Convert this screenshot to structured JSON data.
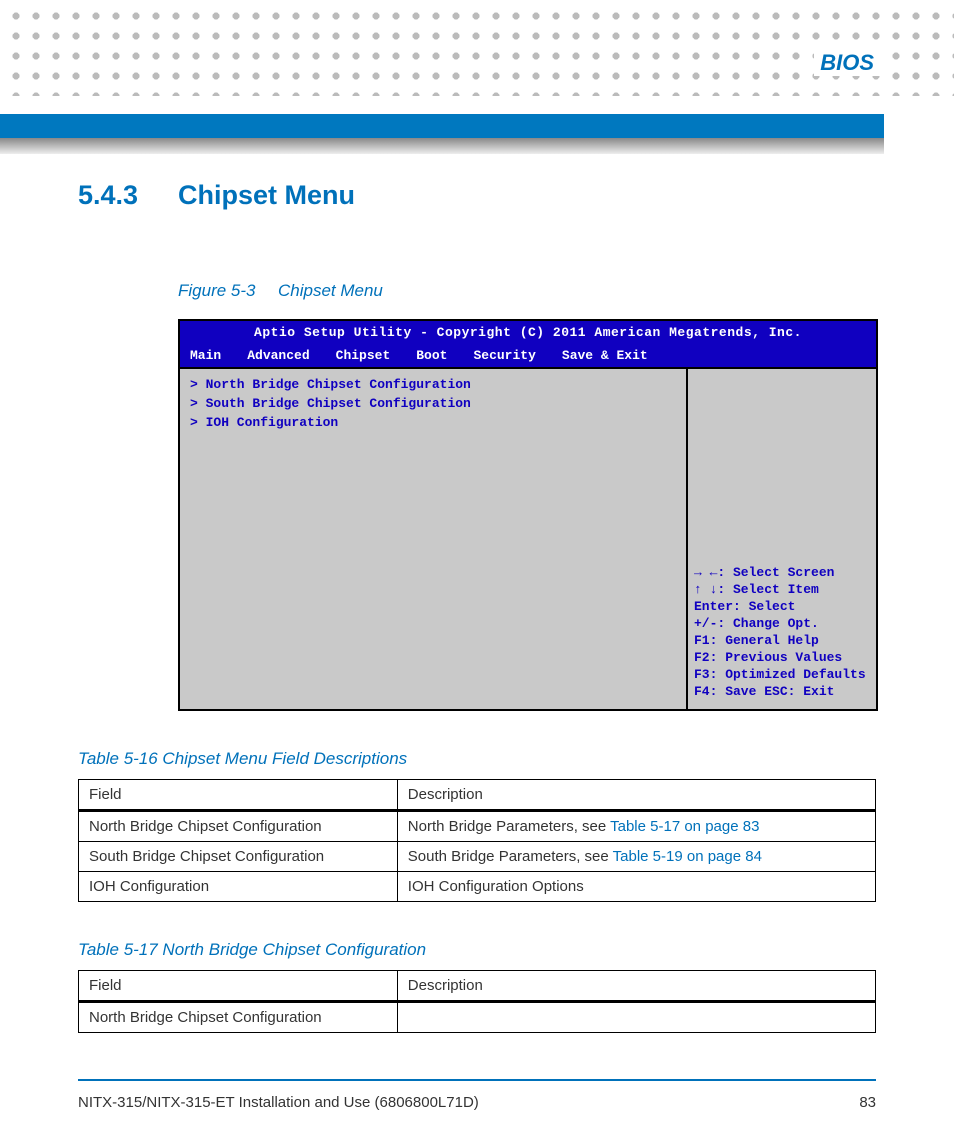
{
  "header": {
    "label": "BIOS"
  },
  "section": {
    "number": "5.4.3",
    "title": "Chipset Menu"
  },
  "figure": {
    "label": "Figure 5-3",
    "title": "Chipset Menu",
    "bios": {
      "topbar": "Aptio Setup Utility - Copyright (C) 2011 American Megatrends, Inc.",
      "tabs": [
        "Main",
        "Advanced",
        "Chipset",
        "Boot",
        "Security",
        "Save & Exit"
      ],
      "left_items": [
        "> North Bridge Chipset Configuration",
        "> South Bridge Chipset Configuration",
        "> IOH Configuration"
      ],
      "help": [
        "→ ←: Select Screen",
        "↑ ↓: Select Item",
        "Enter: Select",
        "+/-: Change Opt.",
        "F1: General Help",
        "F2: Previous Values",
        "F3: Optimized Defaults",
        "F4: Save  ESC: Exit"
      ]
    }
  },
  "table16": {
    "caption": "Table 5-16 Chipset Menu Field Descriptions",
    "headers": [
      "Field",
      "Description"
    ],
    "rows": [
      {
        "field": "North Bridge Chipset Configuration",
        "desc_prefix": "North Bridge Parameters, see ",
        "link": "Table 5-17 on page 83"
      },
      {
        "field": "South Bridge Chipset Configuration",
        "desc_prefix": "South Bridge Parameters, see ",
        "link": "Table 5-19 on page 84"
      },
      {
        "field": "IOH Configuration",
        "desc_prefix": "IOH Configuration Options",
        "link": ""
      }
    ]
  },
  "table17": {
    "caption": "Table 5-17 North Bridge Chipset Configuration",
    "headers": [
      "Field",
      "Description"
    ],
    "rows": [
      {
        "field": "North Bridge Chipset Configuration",
        "desc": ""
      }
    ]
  },
  "footer": {
    "left": "NITX-315/NITX-315-ET Installation and Use (6806800L71D)",
    "page": "83"
  }
}
